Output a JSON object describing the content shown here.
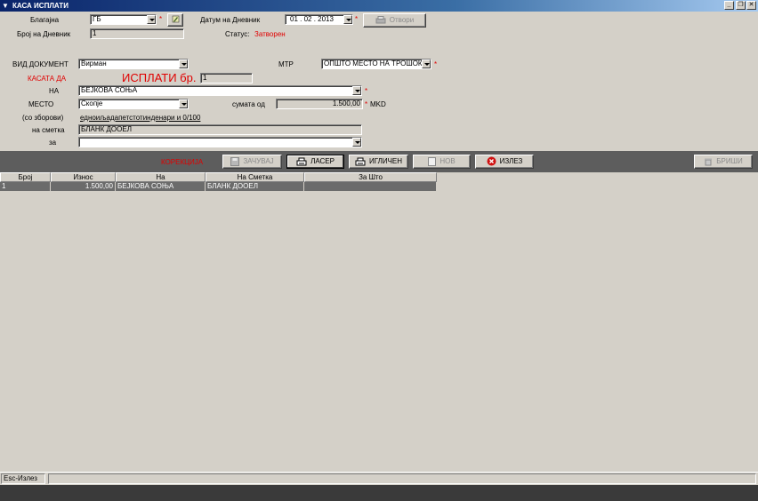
{
  "window": {
    "title": "КАСА ИСПЛАТИ",
    "menu_icon": "down-triangle-icon"
  },
  "header": {
    "blagajna_label": "Благајна",
    "blagajna_value": "ГБ",
    "broj_dnevnik_label": "Број на Дневник",
    "broj_dnevnik_value": "1",
    "datum_label": "Датум на Дневник",
    "datum_value": "01 . 02 . 2013",
    "otvori_label": "Отвори",
    "status_label": "Статус:",
    "status_value": "Затворен",
    "required_mark": "*"
  },
  "form": {
    "vid_label": "ВИД ДОКУМЕНТ",
    "vid_value": "Вирман",
    "mtr_label": "МТР",
    "mtr_value": "ОПШТО МЕСТО НА ТРОШОК",
    "kasata_label": "КАСАТА ДА",
    "isplati_label": "ИСПЛАТИ бр.",
    "isplati_value": "1",
    "na_label": "НА",
    "na_value": "БЕЈКОВА СОЊА",
    "mesto_label": "МЕСТО",
    "mesto_value": "Скопје",
    "sumata_label": "сумата од",
    "sumata_value": "1.500,00",
    "currency": "MKD",
    "zborovi_label": "(со зборови)",
    "zborovi_value": "едноиљадапетстотинденари и 0/100",
    "smetka_label": "на сметка",
    "smetka_value": "БЛАНК ДООЕЛ",
    "za_label": "за",
    "za_value": ""
  },
  "toolbar": {
    "korekcija": "КОРЕКЦИЈА",
    "zacuvaj": "ЗАЧУВАЈ",
    "laser": "ЛАСЕР",
    "iglicen": "ИГЛИЧЕН",
    "nov": "НОВ",
    "izlez": "ИЗЛЕЗ",
    "brishi": "БРИШИ"
  },
  "grid": {
    "columns": [
      "Број",
      "Износ",
      "На",
      "На Сметка",
      "За Што"
    ],
    "rows": [
      [
        "1",
        "1.500,00",
        "БЕЈКОВА СОЊА",
        "БЛАНК ДООЕЛ",
        ""
      ]
    ]
  },
  "statusbar": {
    "hint": "Esc-Излез"
  }
}
